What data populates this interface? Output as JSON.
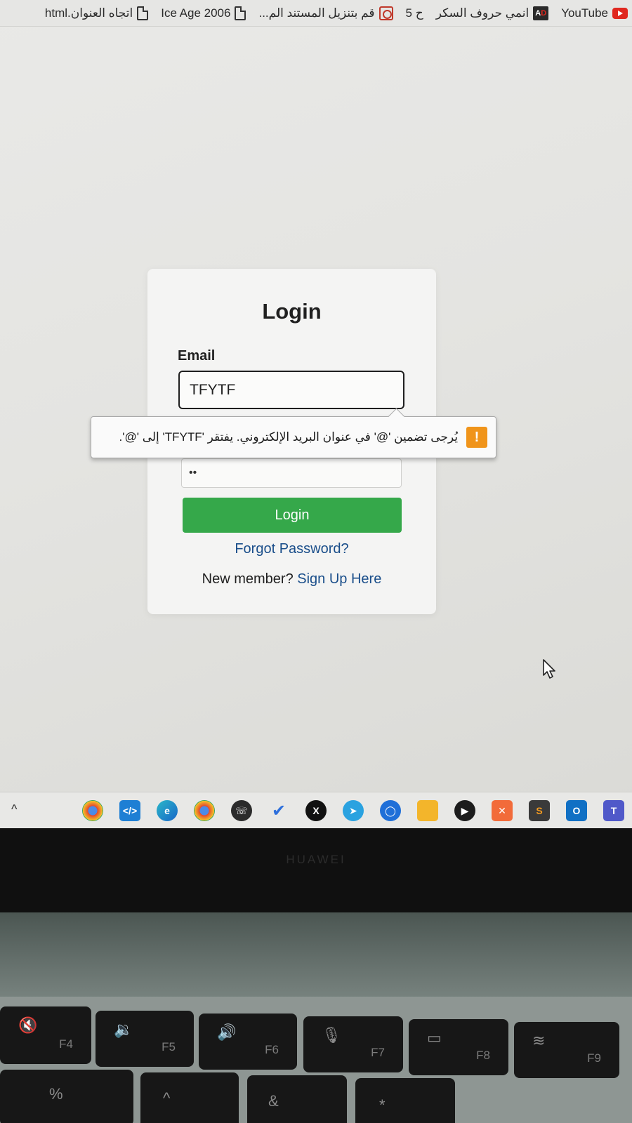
{
  "bookmarks": [
    {
      "label": "YouTube",
      "icon": "youtube-icon"
    },
    {
      "label": "انمي حروف السكر",
      "icon": "ad-logo-icon"
    },
    {
      "label": "قم بتنزيل المستند الم...",
      "icon": "pdf-icon"
    },
    {
      "label": "Ice Age 2006",
      "icon": "document-icon"
    },
    {
      "label": "اتجاه العنوان.html",
      "icon": "document-icon"
    }
  ],
  "bookmark_extra": "ح 5",
  "login": {
    "title": "Login",
    "email_label": "Email",
    "email_value": "TFYTF",
    "password_value": "••",
    "button_label": "Login",
    "forgot_label": "Forgot Password?",
    "new_member_text": "New member?",
    "signup_label": "Sign Up Here"
  },
  "validation_tooltip": {
    "icon": "!",
    "message": "يُرجى تضمين '@' في عنوان البريد الإلكتروني. يفتقر 'TFYTF' إلى '@'."
  },
  "taskbar": {
    "chevron": "^",
    "apps": [
      "chrome-profile",
      "vscode",
      "edge",
      "chrome",
      "whatsapp",
      "todo",
      "x",
      "telegram",
      "chat",
      "file-explorer",
      "media-player",
      "xampp",
      "sublime-text",
      "outlook",
      "teams"
    ]
  },
  "laptop": {
    "brand": "HUAWEI",
    "keys": [
      {
        "fn": "F4",
        "symbol": "🔇"
      },
      {
        "fn": "F5",
        "symbol": "🔉"
      },
      {
        "fn": "F6",
        "symbol": "🔊"
      },
      {
        "fn": "F7",
        "symbol": "🎙"
      },
      {
        "fn": "F8",
        "symbol": "▭"
      },
      {
        "fn": "F9",
        "symbol": "≋"
      }
    ],
    "row2": [
      "%",
      "^",
      "&",
      "*"
    ]
  },
  "colors": {
    "login_button": "#35a84a",
    "link": "#1a4e8a",
    "warning": "#f0941a"
  }
}
